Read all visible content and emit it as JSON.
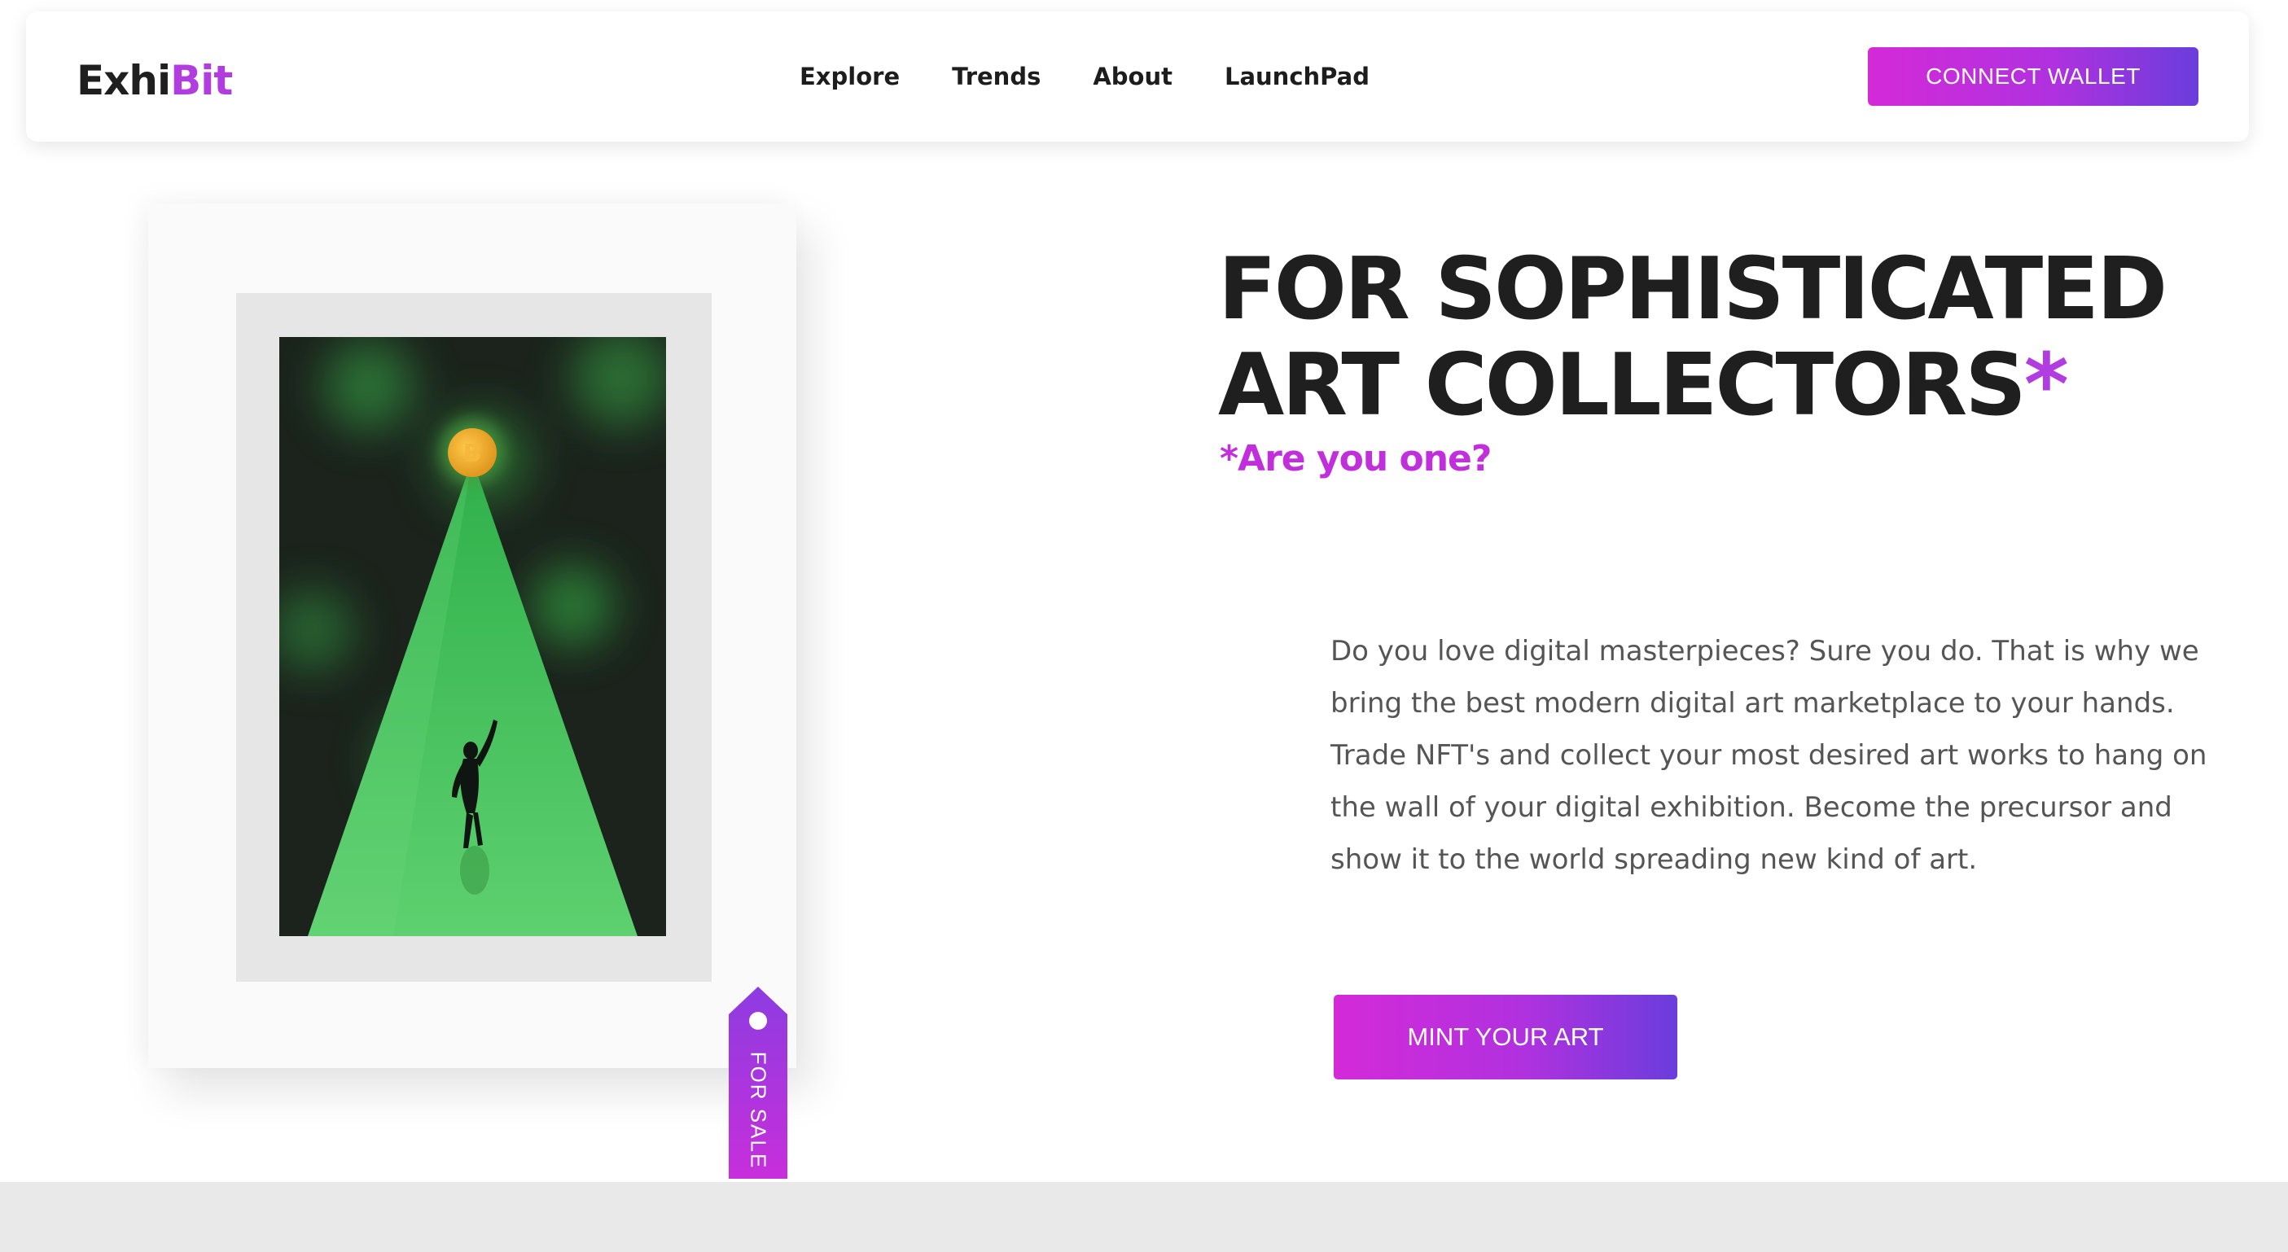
{
  "navbar": {
    "logo_prefix": "Exhi",
    "logo_suffix": "Bit",
    "links": [
      {
        "label": "Explore"
      },
      {
        "label": "Trends"
      },
      {
        "label": "About"
      },
      {
        "label": "LaunchPad"
      }
    ],
    "connect_label": "CONNECT WALLET"
  },
  "hero": {
    "title_line1": "FOR SOPHISTICATED",
    "title_line2": "ART COLLECTORS",
    "title_asterisk": "*",
    "subtitle": "*Are you one?",
    "paragraph": "Do you love digital masterpieces? Sure you do. That is why we bring the best modern digital art marketplace to your hands. Trade NFT's and collect your most desired art works to hang on the wall of your digital exhibition. Become the precursor and show it to the world spreading new kind of art.",
    "cta_label": "MINT YOUR ART"
  },
  "artwork": {
    "tag_label": "FOR SALE",
    "coin_symbol": "B"
  },
  "colors": {
    "accent": "#b13ce0",
    "gradient_start": "#d42ad8",
    "gradient_end": "#6a3ddc",
    "text_dark": "#1f1f1f",
    "text_muted": "#555555"
  },
  "icons": {
    "coin": "bitcoin-coin-icon",
    "tag_hole": "tag-hole-icon"
  }
}
